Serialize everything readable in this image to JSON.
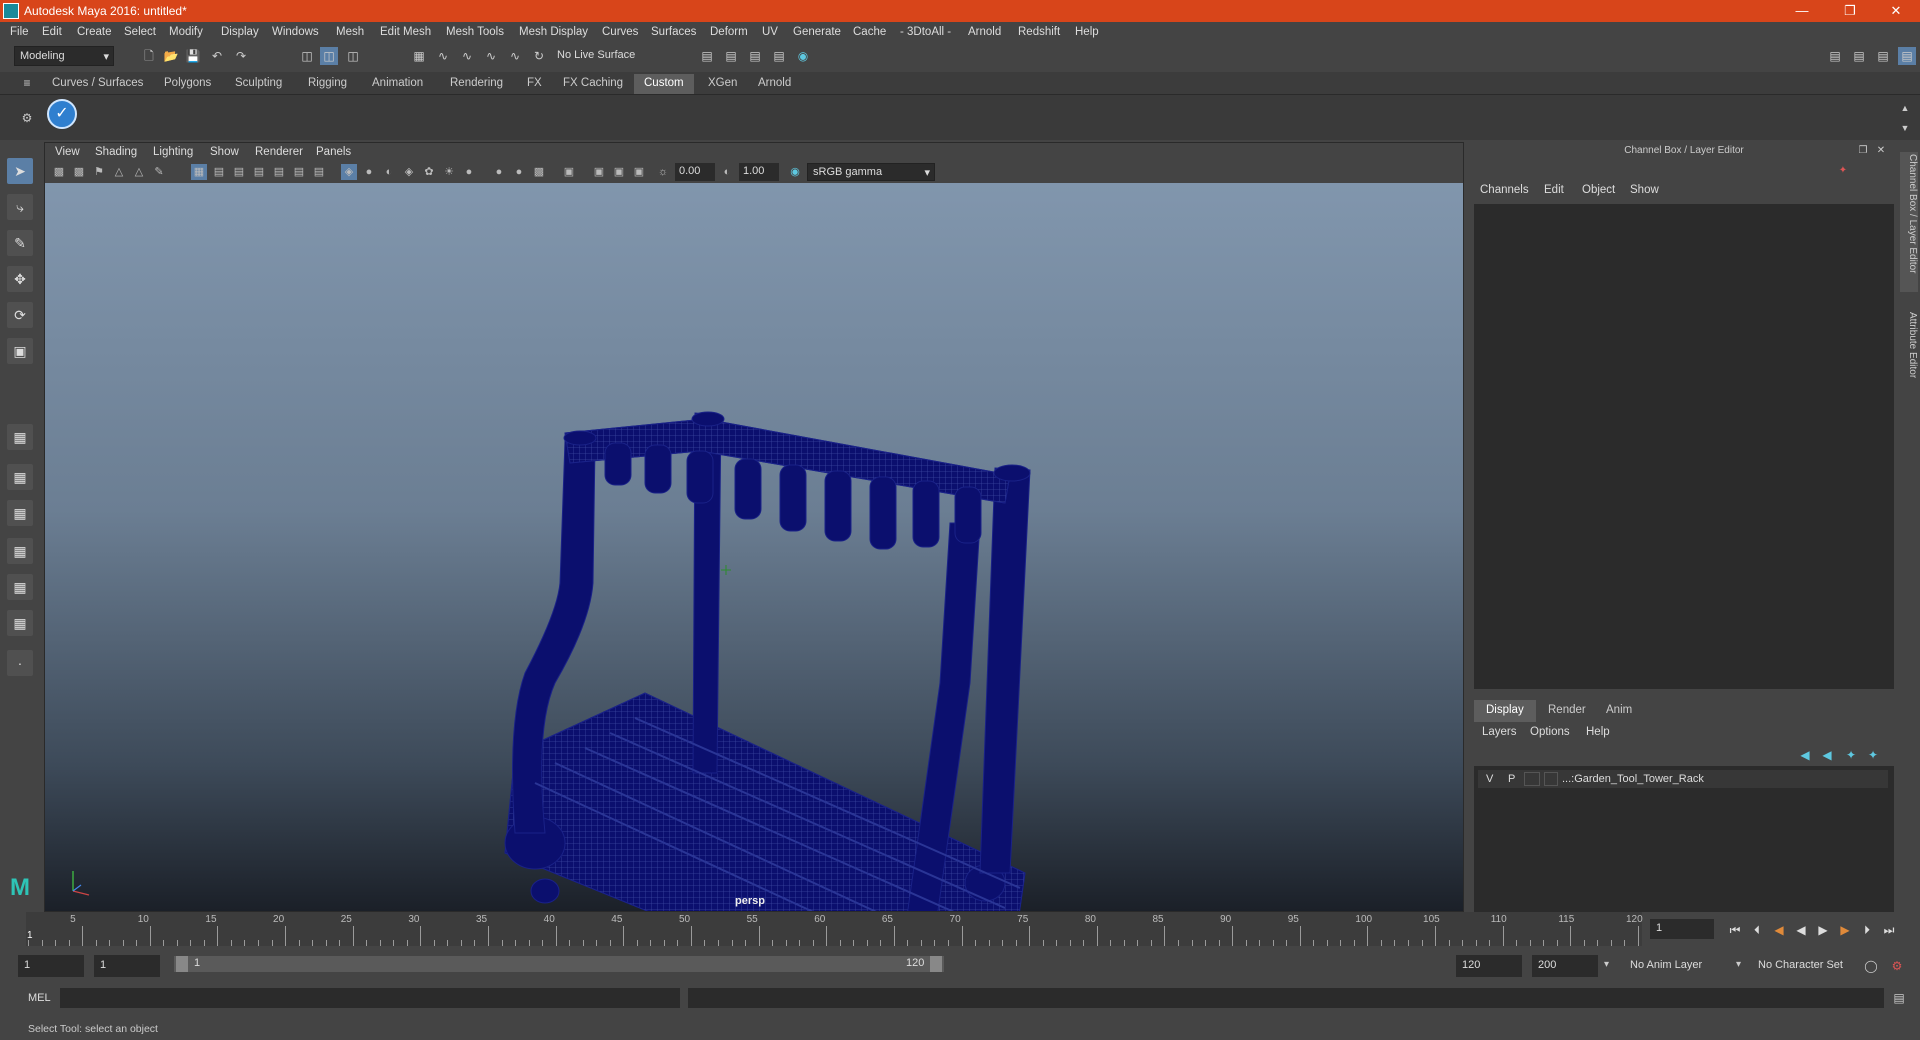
{
  "app": {
    "title": "Autodesk Maya 2016: untitled*",
    "minimize_icon": "minimize-icon",
    "maximize_icon": "restore-icon",
    "close_icon": "close-icon"
  },
  "menus": [
    "File",
    "Edit",
    "Create",
    "Select",
    "Modify",
    "Display",
    "Windows",
    "Mesh",
    "Edit Mesh",
    "Mesh Tools",
    "Mesh Display",
    "Curves",
    "Surfaces",
    "Deform",
    "UV",
    "Generate",
    "Cache",
    "- 3DtoAll -",
    "Arnold",
    "Redshift",
    "Help"
  ],
  "status_line": {
    "mode": "Modeling",
    "live_surface": "No Live Surface"
  },
  "shelf_tabs": [
    "Curves / Surfaces",
    "Polygons",
    "Sculpting",
    "Rigging",
    "Animation",
    "Rendering",
    "FX",
    "FX Caching",
    "Custom",
    "XGen",
    "Arnold"
  ],
  "shelf_active_tab": "Custom",
  "panel_menus": [
    "View",
    "Shading",
    "Lighting",
    "Show",
    "Renderer",
    "Panels"
  ],
  "panel_toolbar": {
    "exposure": "0.00",
    "gamma": "1.00",
    "color_space": "sRGB gamma"
  },
  "viewport": {
    "camera_label": "persp",
    "model_color": "#0b0f6e"
  },
  "channel_box": {
    "header": "Channel Box / Layer Editor",
    "menus": [
      "Channels",
      "Edit",
      "Object",
      "Show"
    ]
  },
  "layer_editor": {
    "tabs": [
      "Display",
      "Render",
      "Anim"
    ],
    "active_tab": "Display",
    "menus": [
      "Layers",
      "Options",
      "Help"
    ],
    "layer": {
      "visible": "V",
      "playback": "P",
      "name": "...:Garden_Tool_Tower_Rack"
    }
  },
  "side_tabs": [
    "Channel Box / Layer Editor",
    "Attribute Editor"
  ],
  "time_slider": {
    "labels": [
      "5",
      "10",
      "15",
      "20",
      "25",
      "30",
      "35",
      "40",
      "45",
      "50",
      "55",
      "60",
      "65",
      "70",
      "75",
      "80",
      "85",
      "90",
      "95",
      "100",
      "105",
      "110",
      "115",
      "120"
    ],
    "current_frame_marker": "1",
    "current_frame_field": "1"
  },
  "range_slider": {
    "start": "1",
    "playback_start": "1",
    "range_start_label": "1",
    "range_end_label": "120",
    "playback_end": "120",
    "end": "200",
    "anim_layer": "No Anim Layer",
    "character_set": "No Character Set"
  },
  "command_line": {
    "lang": "MEL"
  },
  "help_line": "Select Tool: select an object"
}
